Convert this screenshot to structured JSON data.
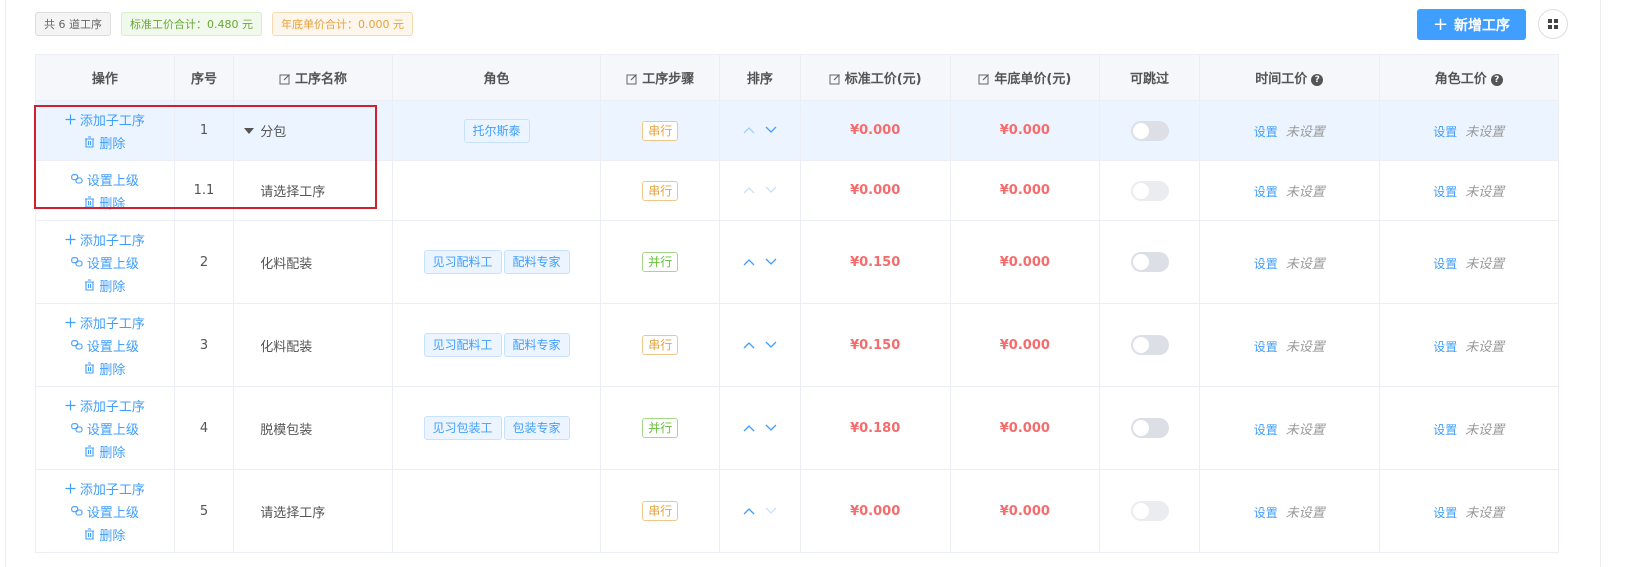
{
  "summary": {
    "count_label": "共 6 道工序",
    "std_total_label": "标准工价合计：0.480 元",
    "year_total_label": "年底单价合计：0.000 元"
  },
  "toolbar": {
    "add_label": "新增工序",
    "grid_icon": "grid-icon"
  },
  "colors": {
    "accent": "#409eff",
    "price": "#f56c6c",
    "serial": "#e6a23c",
    "parallel": "#67c23a",
    "highlight": "#d0202e"
  },
  "table": {
    "headers": {
      "ops": "操作",
      "seq": "序号",
      "name": "工序名称",
      "role": "角色",
      "step": "工序步骤",
      "sort": "排序",
      "std_price": "标准工价(元)",
      "year_price": "年底单价(元)",
      "skippable": "可跳过",
      "time_price": "时间工价",
      "role_price": "角色工价"
    },
    "actions": {
      "add_child": "添加子工序",
      "set_parent": "设置上级",
      "delete": "删除",
      "set": "设置",
      "unset": "未设置"
    },
    "rows": [
      {
        "seq": "1",
        "name": "分包",
        "roles": [
          "托尔斯泰"
        ],
        "step": "串行",
        "std_price": "¥0.000",
        "year_price": "¥0.000"
      },
      {
        "seq": "1.1",
        "name": "请选择工序",
        "roles": [],
        "step": "串行",
        "std_price": "¥0.000",
        "year_price": "¥0.000"
      },
      {
        "seq": "2",
        "name": "化料配装",
        "roles": [
          "见习配料工",
          "配料专家"
        ],
        "step": "并行",
        "std_price": "¥0.150",
        "year_price": "¥0.000"
      },
      {
        "seq": "3",
        "name": "化料配装",
        "roles": [
          "见习配料工",
          "配料专家"
        ],
        "step": "串行",
        "std_price": "¥0.150",
        "year_price": "¥0.000"
      },
      {
        "seq": "4",
        "name": "脱模包装",
        "roles": [
          "见习包装工",
          "包装专家"
        ],
        "step": "并行",
        "std_price": "¥0.180",
        "year_price": "¥0.000"
      },
      {
        "seq": "5",
        "name": "请选择工序",
        "roles": [],
        "step": "串行",
        "std_price": "¥0.000",
        "year_price": "¥0.000"
      }
    ]
  }
}
